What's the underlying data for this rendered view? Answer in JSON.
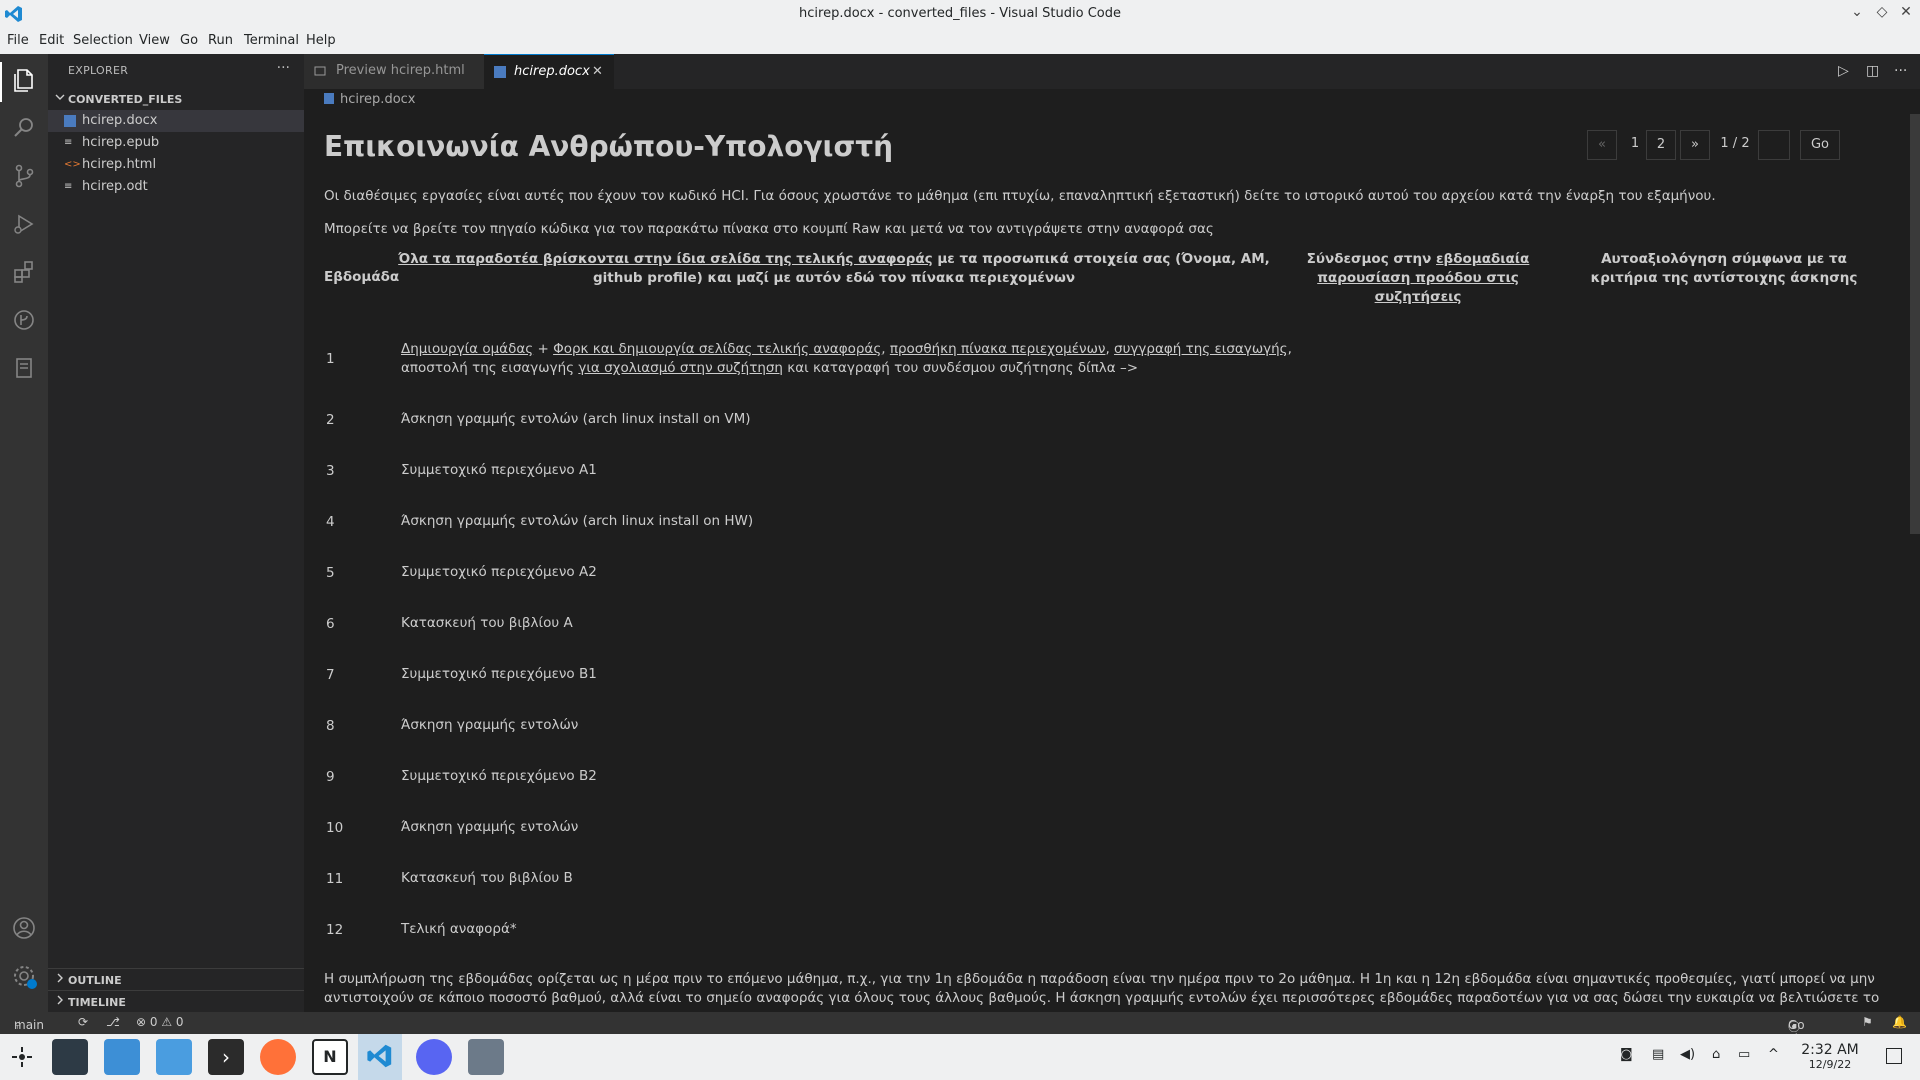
{
  "window": {
    "title": "hcirep.docx - converted_files - Visual Studio Code"
  },
  "menu": [
    "File",
    "Edit",
    "Selection",
    "View",
    "Go",
    "Run",
    "Terminal",
    "Help"
  ],
  "explorer": {
    "header": "EXPLORER",
    "folder": "CONVERTED_FILES",
    "files": [
      {
        "name": "hcirep.docx",
        "icon": "word-file-icon",
        "active": true
      },
      {
        "name": "hcirep.epub",
        "icon": "text-file-icon",
        "active": false
      },
      {
        "name": "hcirep.html",
        "icon": "html-file-icon",
        "active": false
      },
      {
        "name": "hcirep.odt",
        "icon": "text-file-icon",
        "active": false
      }
    ],
    "outline": "OUTLINE",
    "timeline": "TIMELINE"
  },
  "tabs": [
    {
      "label": "Preview hcirep.html",
      "active": false
    },
    {
      "label": "hcirep.docx",
      "active": true
    }
  ],
  "breadcrumb": "hcirep.docx",
  "pager": {
    "prev": "«",
    "p1": "1",
    "p2": "2",
    "next": "»",
    "info": "1 / 2",
    "input": "",
    "go": "Go"
  },
  "document": {
    "title": "Επικοινωνία Ανθρώπου-Υπολογιστή",
    "para1": "Οι διαθέσιμες εργασίες είναι αυτές που έχουν τον κωδικό HCI. Για όσους χρωστάνε το μάθημα (επι πτυχίω, επαναληπτική εξεταστική) δείτε το ιστορικό αυτού του αρχείου κατά την έναρξη του εξαμήνου.",
    "para2": "Μπορείτε να βρείτε τον πηγαίο κώδικα για τον παρακάτω πίνακα στο κουμπί Raw και μετά να τον αντιγράψετε στην αναφορά σας",
    "table_headers": {
      "week": "Εβδομάδα",
      "deliv_u": "Όλα τα παραδοτέα βρίσκονται στην ίδια σελίδα της τελικής αναφοράς",
      "deliv_rest": " με τα προσωπικά στοιχεία σας (Όνομα, ΑΜ, github profile) και μαζί με αυτόν εδώ τον πίνακα περιεχομένων",
      "link_a": "Σύνδεσμος στην ",
      "link_u": "εβδομαδιαία παρουσίαση προόδου στις συζητήσεις",
      "self": "Αυτοαξιολόγηση σύμφωνα με τα κριτήρια της αντίστοιχης άσκησης"
    },
    "row1": {
      "num": "1",
      "a": "Δημιουργία ομάδας",
      "b": " + ",
      "c": "Φορκ και δημιουργία σελίδας τελικής αναφοράς",
      "d": ", ",
      "e": "προσθήκη πίνακα περιεχομένων",
      "f": ", ",
      "g": "συγγραφή της εισαγωγής",
      "h": ", αποστολή της εισαγωγής ",
      "i": "για σχολιασμό στην συζήτηση",
      "j": " και καταγραφή του συνδέσμου συζήτησης δίπλα –>"
    },
    "rows": [
      {
        "num": "2",
        "task": "Άσκηση γραμμής εντολών (arch linux install on VM)"
      },
      {
        "num": "3",
        "task": "Συμμετοχικό περιεχόμενο Α1"
      },
      {
        "num": "4",
        "task": "Άσκηση γραμμής εντολών (arch linux install on HW)"
      },
      {
        "num": "5",
        "task": "Συμμετοχικό περιεχόμενο Α2"
      },
      {
        "num": "6",
        "task": "Κατασκευή του βιβλίου Α"
      },
      {
        "num": "7",
        "task": "Συμμετοχικό περιεχόμενο Β1"
      },
      {
        "num": "8",
        "task": "Άσκηση γραμμής εντολών"
      },
      {
        "num": "9",
        "task": "Συμμετοχικό περιεχόμενο Β2"
      },
      {
        "num": "10",
        "task": "Άσκηση γραμμής εντολών"
      },
      {
        "num": "11",
        "task": "Κατασκευή του βιβλίου Β"
      },
      {
        "num": "12",
        "task": "Τελική αναφορά*"
      }
    ],
    "footer": "Η συμπλήρωση της εβδομάδας ορίζεται ως η μέρα πριν το επόμενο μάθημα, π.χ., για την 1η εβδομάδα η παράδοση είναι την ημέρα πριν το 2ο μάθημα. Η 1η και η 12η εβδομάδα είναι σημαντικές προθεσμίες, γιατί μπορεί να μην αντιστοιχούν σε κάποιο ποσοστό βαθμού, αλλά είναι το σημείο αναφοράς για όλους τους άλλους βαθμούς. Η άσκηση γραμμής εντολών έχει περισσότερες εβδομάδες παραδοτέων για να σας δώσει την ευκαιρία να βελτιώσετε το λειτουργικό"
  },
  "status": {
    "branch": "main",
    "problems": "⊗ 0 ⚠ 0",
    "golive": "Go Live"
  },
  "taskbar": {
    "time": "2:32 AM",
    "date": "12/9/22"
  },
  "colors": {
    "accent": "#007acc",
    "activitybar": "#333333",
    "sidebar": "#252526",
    "editor": "#1e1e1e"
  }
}
